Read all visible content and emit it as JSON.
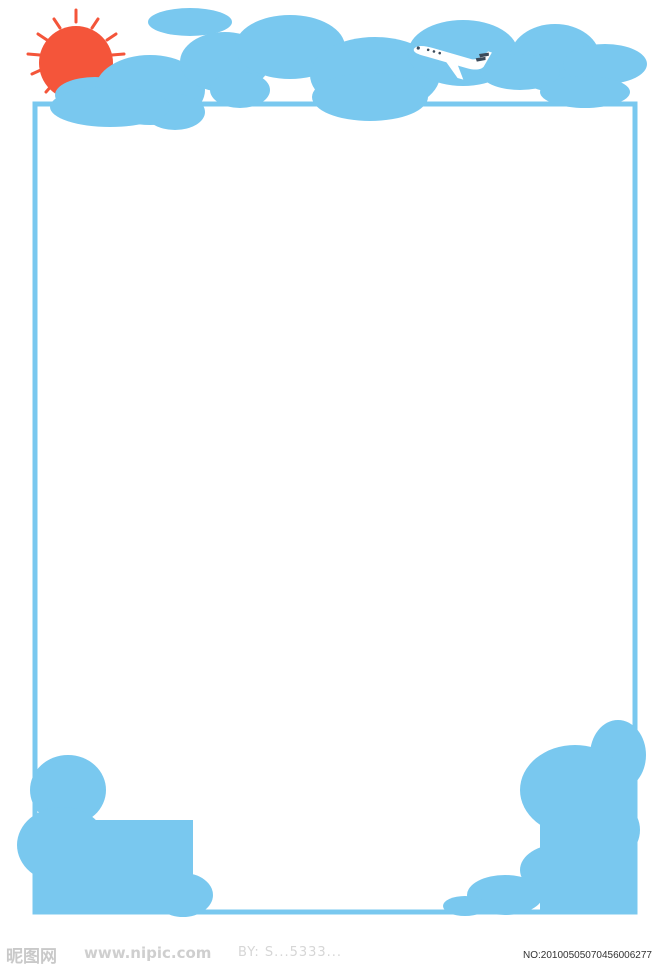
{
  "colors": {
    "sky_blue": "#79c8ef",
    "sun_red": "#f4553a",
    "background": "#ffffff",
    "airplane_body": "#ffffff",
    "airplane_stripe": "#3b4a5a"
  },
  "icons": [
    "sun-icon",
    "cloud-icon",
    "airplane-icon"
  ],
  "watermark": {
    "logo_text": "昵图网",
    "url_text": "www.nipic.com",
    "by_text": "BY: S...5333...",
    "serial_text": "NO:20100505070456006277"
  }
}
